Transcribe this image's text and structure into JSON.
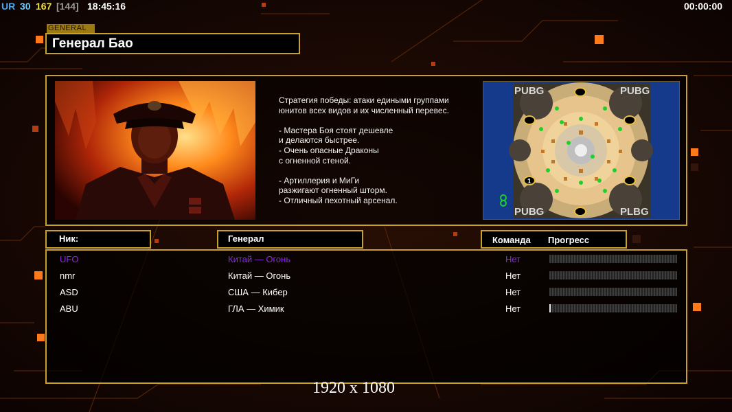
{
  "status_bar": {
    "label_ur": "UR",
    "value_1": "30",
    "value_2": "167",
    "value_3": "[144]",
    "clock": "18:45:16",
    "timer": "00:00:00",
    "colors": {
      "ur": "#3fa9ff",
      "value_1": "#6ecbff",
      "value_2": "#f5e23a",
      "value_3": "#9a9a9a"
    }
  },
  "general": {
    "section_tag": "GENERAL",
    "name": "Генерал Бао",
    "strategy_lines": [
      "Стратегия победы: атаки едиными группами",
      "юнитов всех видов и их численный перевес.",
      "",
      "- Мастера Боя стоят дешевле",
      "и делаются быстрее.",
      "- Очень опасные Драконы",
      "с огненной стеной.",
      "",
      "- Артиллерия и МиГи",
      "разжигают огненный шторм.",
      "- Отличный пехотный арсенал."
    ]
  },
  "map": {
    "corner_labels": [
      "PUBG",
      "PUBG",
      "PUBG",
      "PLBG"
    ],
    "start_marker": "1",
    "colors": {
      "sand": "#e6c48b",
      "water": "#153a8c",
      "rock": "#4a4238"
    }
  },
  "table": {
    "headers": {
      "nick": "Ник:",
      "general": "Генерал",
      "team": "Команда",
      "progress": "Прогресс"
    },
    "players": [
      {
        "nick": "UFO",
        "general": "Китай — Огонь",
        "team": "Нет",
        "progress": 0,
        "color": "#8a2be2"
      },
      {
        "nick": "nmr",
        "general": "Китай — Огонь",
        "team": "Нет",
        "progress": 0,
        "color": "#ffffff"
      },
      {
        "nick": "ASD",
        "general": "США — Кибер",
        "team": "Нет",
        "progress": 0,
        "color": "#ffffff"
      },
      {
        "nick": "ABU",
        "general": "ГЛА — Химик",
        "team": "Нет",
        "progress": 0.01,
        "color": "#ffffff"
      }
    ]
  },
  "resolution_text": "1920 x 1080",
  "theme": {
    "accent": "#c8a12a",
    "background": "#140704",
    "glow": "#ff7a1a"
  }
}
